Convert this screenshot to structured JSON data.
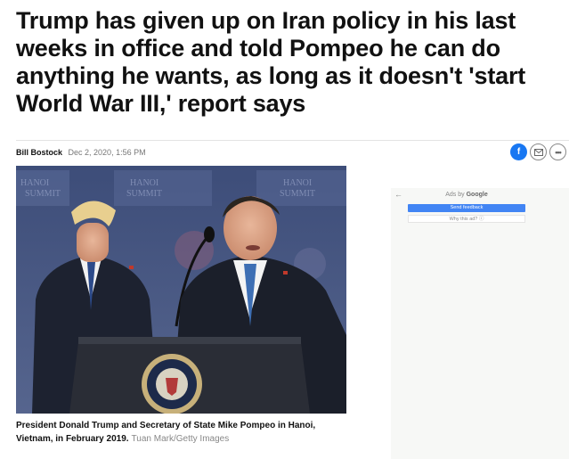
{
  "article": {
    "headline": "Trump has given up on Iran policy in his last weeks in office and told Pompeo he can do anything he wants, as long as it doesn't 'start World War III,' report says",
    "author": "Bill Bostock",
    "date": "Dec 2, 2020, 1:56 PM",
    "caption": "President Donald Trump and Secretary of State Mike Pompeo in Hanoi, Vietnam, in February 2019.",
    "credit": "Tuan Mark/Getty Images"
  },
  "photo": {
    "backdrop_text": [
      "HANOI",
      "SUMMIT",
      "HANOI",
      "SUMMIT",
      "HANOI",
      "SUMMIT"
    ]
  },
  "share": {
    "facebook_glyph": "f",
    "mail_icon": "mail-icon",
    "more_glyph": "•••"
  },
  "ad": {
    "back_glyph": "←",
    "ads_by": "Ads by",
    "google": "Google",
    "send_feedback": "Send feedback",
    "why_this_ad": "Why this ad?"
  },
  "colors": {
    "facebook": "#1877f2",
    "feedback_button": "#4285f4",
    "backdrop": "#4a5a86"
  }
}
